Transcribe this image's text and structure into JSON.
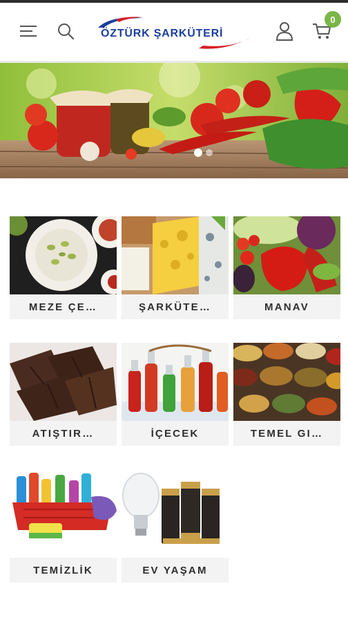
{
  "header": {
    "logo_text": "ÖZTÜRK ŞARKÜTERİ",
    "cart_count": "0",
    "icons": [
      "menu-icon",
      "search-icon",
      "account-icon",
      "cart-icon"
    ],
    "colors": {
      "brand_blue": "#1b3f9a",
      "brand_red": "#d62027",
      "badge_green": "#7ab648"
    }
  },
  "banner": {
    "slides": 2,
    "active_slide": 1
  },
  "categories": [
    {
      "label": "MEZE ÇE…",
      "icon": "meze-image"
    },
    {
      "label": "ŞARKÜTE…",
      "icon": "cheese-image"
    },
    {
      "label": "MANAV",
      "icon": "vegetables-image"
    },
    {
      "label": "ATIŞTIR…",
      "icon": "chocolate-image"
    },
    {
      "label": "İÇECEK",
      "icon": "drinks-image"
    },
    {
      "label": "TEMEL GI…",
      "icon": "spices-image"
    },
    {
      "label": "TEMİZLİK",
      "icon": "cleaning-image"
    },
    {
      "label": "EV YAŞAM",
      "icon": "home-living-image"
    }
  ]
}
